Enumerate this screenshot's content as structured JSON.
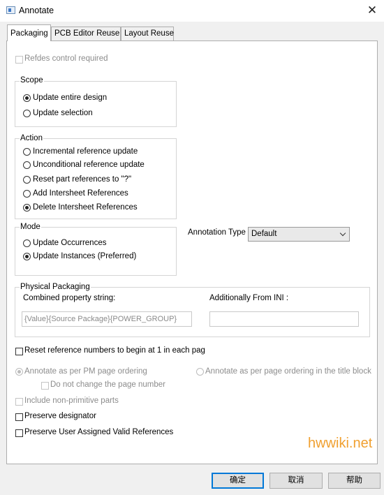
{
  "window": {
    "title": "Annotate",
    "close_glyph": "✕",
    "app_icon": "dialog-window-icon"
  },
  "tabs": [
    {
      "label": "Packaging",
      "active": true
    },
    {
      "label": "PCB Editor Reuse",
      "active": false
    },
    {
      "label": "Layout Reuse",
      "active": false
    }
  ],
  "refdes_control": {
    "label": "Refdes control required",
    "checked": false,
    "enabled": false
  },
  "scope": {
    "label": "Scope",
    "options": [
      {
        "label": "Update entire design",
        "selected": true
      },
      {
        "label": "Update selection",
        "selected": false
      }
    ]
  },
  "action": {
    "label": "Action",
    "options": [
      {
        "label": "Incremental reference update",
        "selected": false
      },
      {
        "label": "Unconditional reference update",
        "selected": false
      },
      {
        "label": "Reset part references to \"?\"",
        "selected": false
      },
      {
        "label": "Add Intersheet References",
        "selected": false
      },
      {
        "label": "Delete Intersheet References",
        "selected": true
      }
    ]
  },
  "mode": {
    "label": "Mode",
    "options": [
      {
        "label": "Update Occurrences",
        "selected": false
      },
      {
        "label": "Update Instances (Preferred)",
        "selected": true
      }
    ]
  },
  "annotation_type": {
    "label": "Annotation Type",
    "value": "Default"
  },
  "physical_packaging": {
    "label": "Physical Packaging",
    "combined_label": "Combined property string:",
    "combined_value": "{Value}{Source Package}{POWER_GROUP}",
    "ini_label": "Additionally From INI :",
    "ini_value": ""
  },
  "reset_numbers": {
    "label": "Reset reference numbers to begin at 1 in each pag",
    "checked": false
  },
  "page_ordering": {
    "pm_label": "Annotate as per PM page ordering",
    "pm_selected": true,
    "title_block_label": "Annotate as per page ordering in the title block",
    "title_block_selected": false,
    "no_change_page": "Do not change the page number"
  },
  "include_non_primitive": {
    "label": "Include non-primitive parts",
    "checked": false,
    "enabled": false
  },
  "preserve_designator": {
    "label": "Preserve designator",
    "checked": false
  },
  "preserve_user_refs": {
    "label": "Preserve User Assigned Valid References",
    "checked": false
  },
  "watermark": "hwwiki.net",
  "buttons": {
    "ok": "确定",
    "cancel": "取消",
    "help": "帮助"
  },
  "colors": {
    "accent": "#0078d7",
    "watermark": "#f0a030",
    "disabled": "#8c8c8c"
  }
}
